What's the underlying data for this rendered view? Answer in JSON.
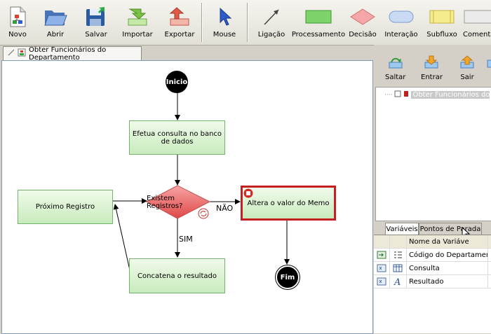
{
  "toolbar": {
    "items": [
      {
        "label": "Novo"
      },
      {
        "label": "Abrir"
      },
      {
        "label": "Salvar"
      },
      {
        "label": "Importar"
      },
      {
        "label": "Exportar"
      },
      {
        "label": "Mouse"
      },
      {
        "label": "Ligação"
      },
      {
        "label": "Processamento"
      },
      {
        "label": "Decisão"
      },
      {
        "label": "Interação"
      },
      {
        "label": "Subfluxo"
      },
      {
        "label": "Comentá"
      }
    ]
  },
  "document_tab": {
    "label": "Obter Funcionários do Departamento"
  },
  "flow": {
    "start": "Inicio",
    "end": "Fim",
    "query": "Efetua consulta no banco de dados",
    "decision": "Existem Registros?",
    "next": "Próximo Registro",
    "memo": "Altera o valor do Memo",
    "concat": "Concatena o resultado",
    "yes": "SIM",
    "no": "NÃO"
  },
  "debug_panel": {
    "buttons": [
      {
        "label": "Saltar"
      },
      {
        "label": "Entrar"
      },
      {
        "label": "Sair"
      }
    ],
    "tree_item": "Obter Funcionários do D"
  },
  "variables": {
    "tabs": [
      {
        "label": "Variáveis"
      },
      {
        "label": "Pontos de Parada"
      }
    ],
    "header": "Nome da Variáve",
    "rows": [
      {
        "name": "Código do Departamento"
      },
      {
        "name": "Consulta"
      },
      {
        "name": "Resultado"
      }
    ]
  }
}
